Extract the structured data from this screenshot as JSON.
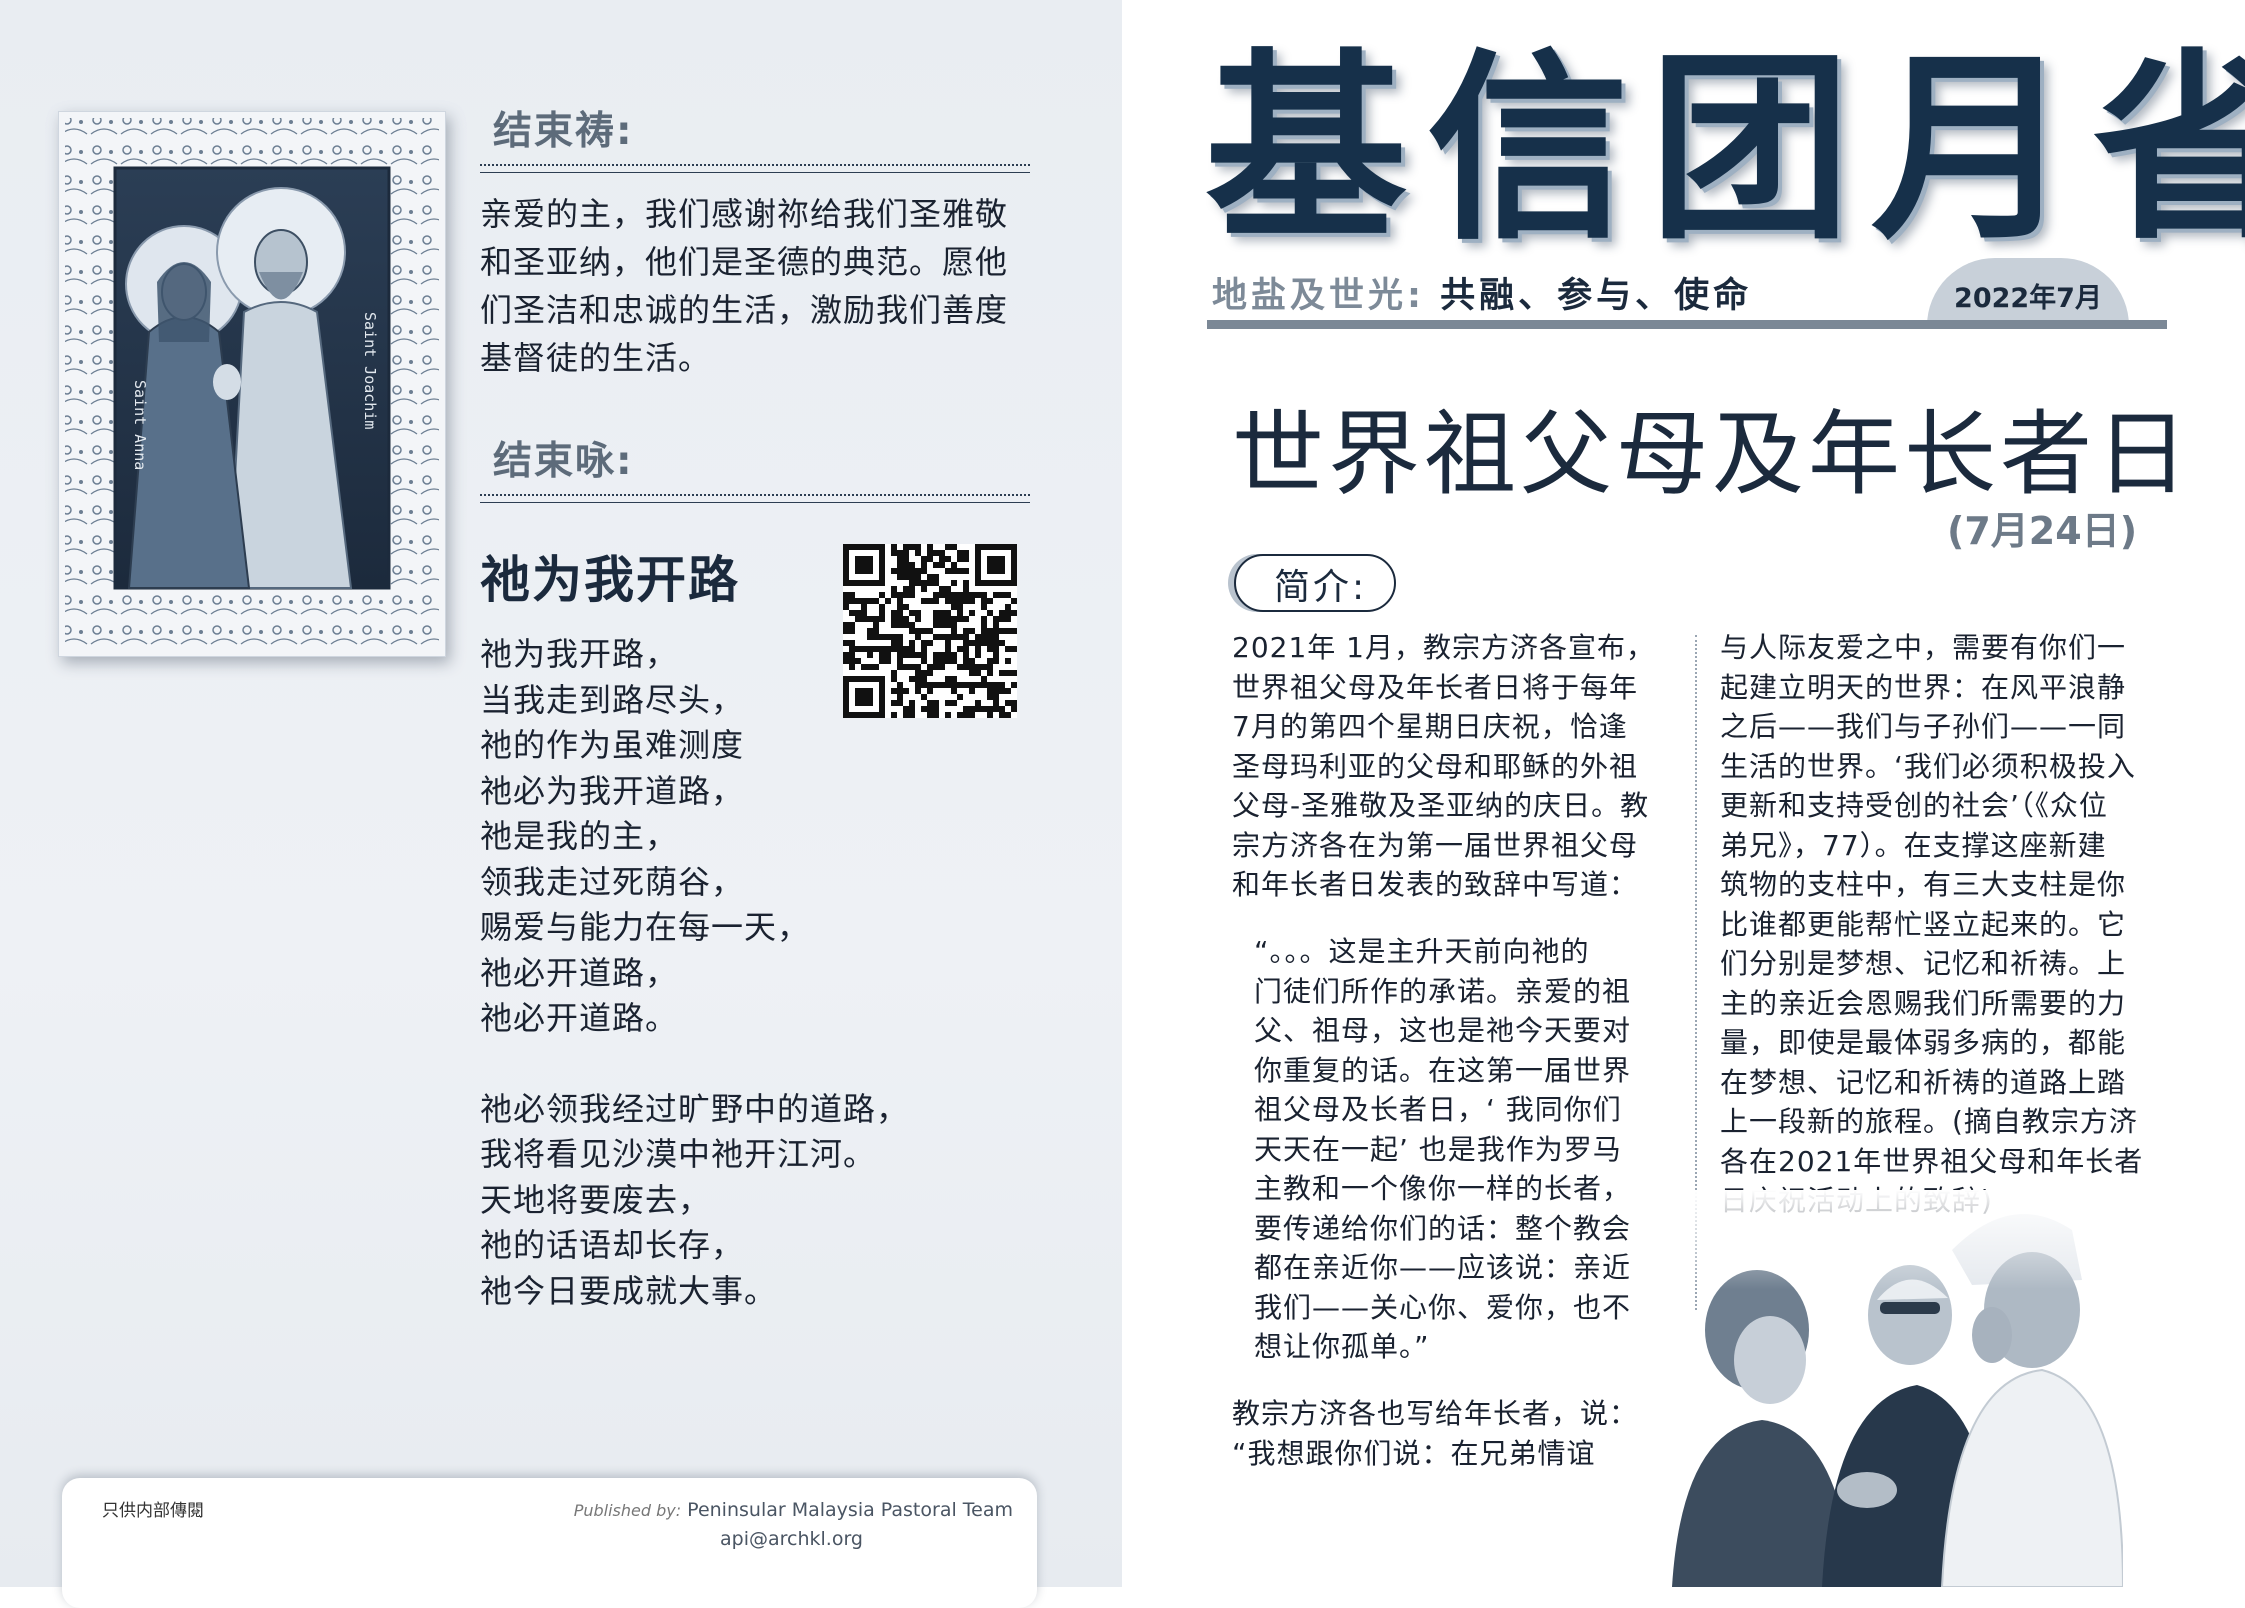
{
  "icon": {
    "name_left": "Saint Anna",
    "name_right": "Saint Joachim"
  },
  "closing_prayer": {
    "heading": "结束祷:",
    "lines": [
      "亲爱的主，我们感谢祢给我们圣雅敬",
      "和圣亚纳，他们是圣德的典范。愿他",
      "们圣洁和忠诚的生活，激励我们善度",
      "基督徒的生活。"
    ]
  },
  "closing_hymn": {
    "heading": "结束咏:",
    "title": "祂为我开路",
    "stanza1": [
      "祂为我开路，",
      "当我走到路尽头，",
      "祂的作为虽难测度",
      "祂必为我开道路，",
      "祂是我的主，",
      "领我走过死荫谷，",
      "赐爱与能力在每一天，",
      "祂必开道路，",
      "祂必开道路。"
    ],
    "stanza2": [
      "祂必领我经过旷野中的道路，",
      "我将看见沙漠中祂开江河。",
      "天地将要废去，",
      "祂的话语却长存，",
      "祂今日要成就大事。"
    ]
  },
  "footer": {
    "internal": "只供内部傳閱",
    "published_by_label": "Published by:",
    "publisher": "Peninsular Malaysia Pastoral Team",
    "email": "api@archkl.org"
  },
  "masthead": {
    "title": "基信团月省",
    "tagline_gray": "地盐及世光:",
    "tagline_dark": "共融、参与、使命",
    "issue_date": "2022年7月"
  },
  "article": {
    "title": "世界祖父母及年长者日",
    "date": "(7月24日)",
    "intro_label": "简介:",
    "col1_lines": [
      "2021年 1月，教宗方济各宣布，",
      "世界祖父母及年长者日将于每年",
      "7月的第四个星期日庆祝，恰逢",
      "圣母玛利亚的父母和耶稣的外祖",
      "父母-圣雅敬及圣亚纳的庆日。教",
      "宗方济各在为第一届世界祖父母",
      "和年长者日发表的致辞中写道："
    ],
    "quote_lines": [
      "“。。。这是主升天前向祂的",
      "门徒们所作的承诺。亲爱的祖",
      "父、祖母，这也是祂今天要对",
      "你重复的话。在这第一届世界",
      "祖父母及长者日，‘ 我同你们",
      "天天在一起’ 也是我作为罗马",
      "主教和一个像你一样的长者，",
      "要传递给你们的话：整个教会",
      "都在亲近你——应该说：亲近",
      "我们——关心你、爱你，也不",
      "想让你孤单。”"
    ],
    "tail_lines": [
      "教宗方济各也写给年长者，说：",
      "“我想跟你们说：在兄弟情谊"
    ],
    "col2_lines": [
      "与人际友爱之中，需要有你们一",
      "起建立明天的世界：在风平浪静",
      "之后——我们与子孙们——一同",
      "生活的世界。‘我们必须积极投入",
      "更新和支持受创的社会’（《众位",
      "弟兄》，77）。在支撑这座新建",
      "筑物的支柱中，有三大支柱是你",
      "比谁都更能帮忙竖立起来的。它",
      "们分别是梦想、记忆和祈祷。上",
      "主的亲近会恩赐我们所需要的力",
      "量，即使是最体弱多病的，都能",
      "在梦想、记忆和祈祷的道路上踏",
      "上一段新的旅程。(摘自教宗方济",
      "各在2021年世界祖父母和年长者",
      "日庆祝活动上的致辞)"
    ]
  },
  "colors": {
    "navy": "#16304a",
    "slate": "#7b8896",
    "page_bg": "#e9edf2"
  }
}
